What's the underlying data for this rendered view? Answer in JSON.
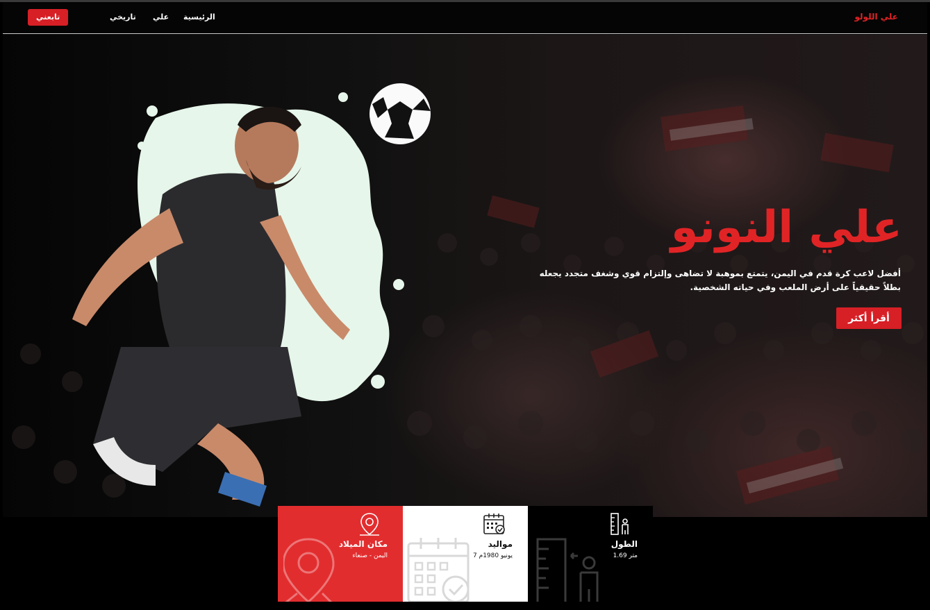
{
  "nav": {
    "brand": "علي اللولو",
    "home": "الرئيسية",
    "ali": "علي",
    "history": "تاريخي",
    "follow": "تابعني"
  },
  "hero": {
    "title": "علي النونو",
    "description": "أفضل لاعب كرة قدم في اليمن، يتمتع بموهبة لا تضاهى وإلتزام قوي وشغف متجدد يجعله بطلاً حقيقياً على أرض الملعب وفي حياته الشخصية.",
    "read_more": "أقرأ أكثر"
  },
  "cards": {
    "height": {
      "label": "الطول",
      "value": "1.69 متر",
      "icon": "height-ruler-icon"
    },
    "birth": {
      "label": "مواليد",
      "value": "7 يونيو 1980م",
      "icon": "calendar-icon"
    },
    "place": {
      "label": "مكان الميلاد",
      "value": "اليمن - صنعاء",
      "icon": "location-pin-icon"
    }
  },
  "colors": {
    "accent": "#d71f26",
    "card_red": "#e22d2f",
    "background": "#000000"
  }
}
